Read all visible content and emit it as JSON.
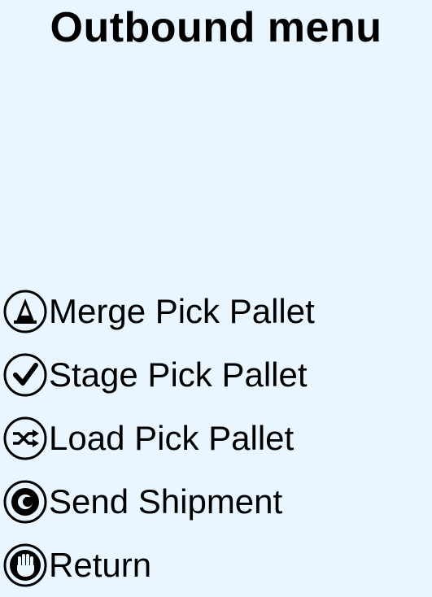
{
  "title": "Outbound menu",
  "menu": {
    "items": [
      {
        "label": "Merge Pick Pallet",
        "icon": "traffic-cone-icon"
      },
      {
        "label": "Stage Pick Pallet",
        "icon": "checkmark-icon"
      },
      {
        "label": "Load Pick Pallet",
        "icon": "shuffle-icon"
      },
      {
        "label": "Send Shipment",
        "icon": "send-circle-icon"
      },
      {
        "label": "Return",
        "icon": "hand-stop-icon"
      }
    ]
  },
  "colors": {
    "background": "#eaf6ff",
    "text": "#000000"
  }
}
